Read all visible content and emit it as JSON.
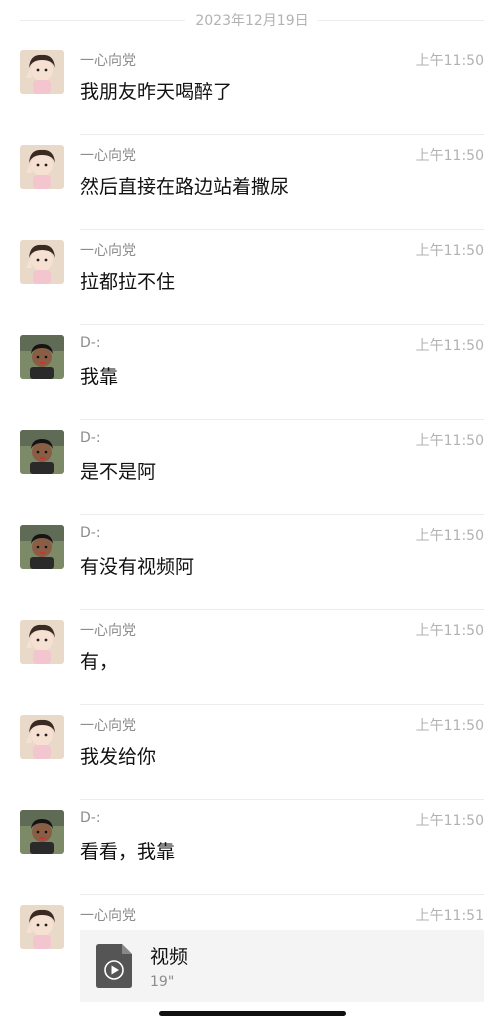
{
  "date": "2023年12月19日",
  "messages": [
    {
      "sender": "一心向党",
      "time": "上午11:50",
      "text": "我朋友昨天喝醉了",
      "avatar": "girl"
    },
    {
      "sender": "一心向党",
      "time": "上午11:50",
      "text": "然后直接在路边站着撒尿",
      "avatar": "girl"
    },
    {
      "sender": "一心向党",
      "time": "上午11:50",
      "text": "拉都拉不住",
      "avatar": "girl"
    },
    {
      "sender": "D-:",
      "time": "上午11:50",
      "text": "我靠",
      "avatar": "boy"
    },
    {
      "sender": "D-:",
      "time": "上午11:50",
      "text": "是不是阿",
      "avatar": "boy"
    },
    {
      "sender": "D-:",
      "time": "上午11:50",
      "text": "有没有视频阿",
      "avatar": "boy"
    },
    {
      "sender": "一心向党",
      "time": "上午11:50",
      "text": "有，",
      "avatar": "girl"
    },
    {
      "sender": "一心向党",
      "time": "上午11:50",
      "text": "我发给你",
      "avatar": "girl"
    },
    {
      "sender": "D-:",
      "time": "上午11:50",
      "text": "看看，我靠",
      "avatar": "boy"
    },
    {
      "sender": "一心向党",
      "time": "上午11:51",
      "text": "",
      "avatar": "girl"
    }
  ],
  "video": {
    "title": "视频",
    "duration": "19\"",
    "icon": "video-file-icon"
  }
}
